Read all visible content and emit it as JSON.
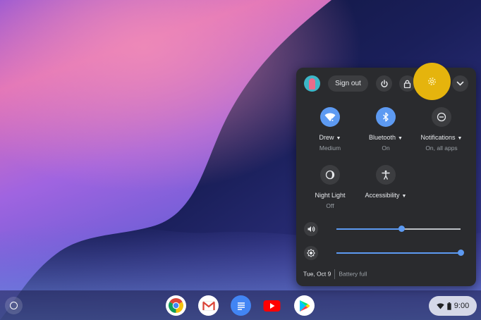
{
  "header": {
    "signout_label": "Sign out"
  },
  "tiles": [
    {
      "label": "Drew",
      "sub": "Medium",
      "icon": "wifi-icon",
      "state": "on"
    },
    {
      "label": "Bluetooth",
      "sub": "On",
      "icon": "bluetooth-icon",
      "state": "on"
    },
    {
      "label": "Notifications",
      "sub": "On, all apps",
      "icon": "do-not-disturb-icon",
      "state": "off"
    },
    {
      "label": "Night Light",
      "sub": "Off",
      "icon": "night-light-icon",
      "state": "off"
    },
    {
      "label": "Accessibility",
      "sub": "",
      "icon": "accessibility-icon",
      "state": "off"
    }
  ],
  "sliders": {
    "volume": {
      "icon": "volume-icon",
      "level": 0.52
    },
    "brightness": {
      "icon": "brightness-icon",
      "level": 1.0
    }
  },
  "footer": {
    "date": "Tue, Oct 9",
    "battery": "Battery full"
  },
  "shelf": {
    "apps": [
      "chrome-icon",
      "gmail-icon",
      "docs-icon",
      "youtube-icon",
      "play-store-icon"
    ],
    "time": "9:00"
  },
  "colors": {
    "accent": "#5d9af2",
    "highlight": "#e5b40d",
    "panel": "#2a2b2e"
  }
}
